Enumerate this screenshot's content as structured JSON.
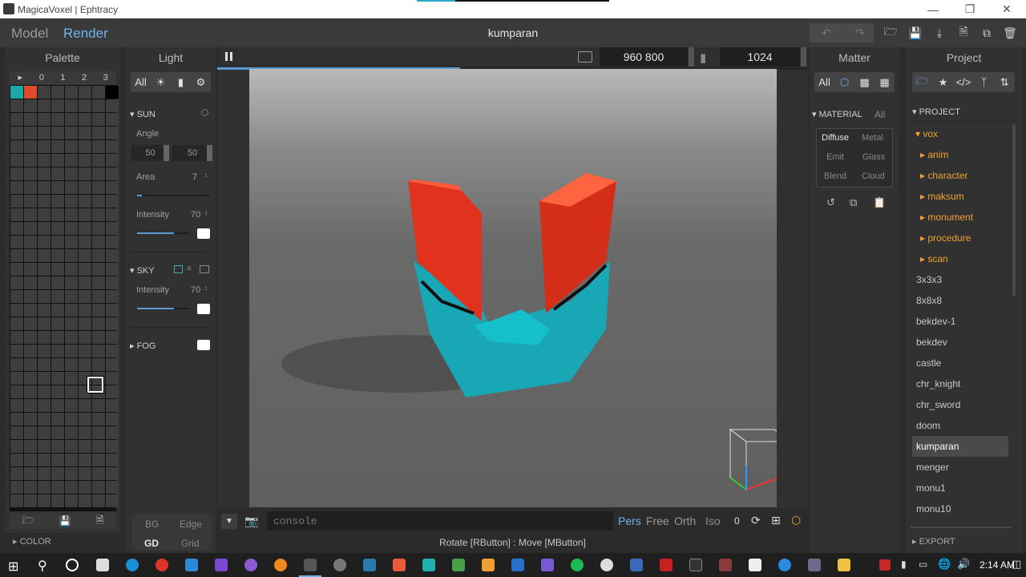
{
  "window": {
    "title": "MagicaVoxel | Ephtracy"
  },
  "appbar": {
    "mode_model": "Model",
    "mode_render": "Render",
    "doc_title": "kumparan"
  },
  "palette": {
    "header": "Palette",
    "page_tabs": [
      "▸",
      "0",
      "1",
      "2",
      "3"
    ],
    "colors": [
      "#1aa7a8",
      "#e04a2a"
    ],
    "footer_label": "COLOR"
  },
  "light": {
    "header": "Light",
    "filter_all": "All",
    "sun": {
      "label": "SUN",
      "angle_label": "Angle",
      "angle_a": "50",
      "angle_b": "50",
      "area_label": "Area",
      "area_value": "7",
      "intensity_label": "Intensity",
      "intensity_value": "70",
      "intensity_fraction": 0.7
    },
    "sky": {
      "label": "SKY",
      "intensity_label": "Intensity",
      "intensity_value": "70",
      "intensity_fraction": 0.7
    },
    "fog_label": "FOG",
    "bottom": {
      "bg": "BG",
      "edge": "Edge",
      "gd": "GD",
      "grid": "Grid"
    }
  },
  "render_toolbar": {
    "resolution": "960  800",
    "samples": "1024",
    "progress_fraction": 0.43
  },
  "console": {
    "placeholder": "console",
    "views": [
      "Pers",
      "Free",
      "Orth",
      "Iso"
    ],
    "iso_value": "0",
    "status": "Rotate [RButton] : Move [MButton]"
  },
  "matter": {
    "header": "Matter",
    "filter_all": "All",
    "material_label": "MATERIAL",
    "material_all": "All",
    "materials": [
      "Diffuse",
      "Metal",
      "Emit",
      "Glass",
      "Blend",
      "Cloud"
    ]
  },
  "project": {
    "header": "Project",
    "section": "PROJECT",
    "root_folder": "vox",
    "folders": [
      "anim",
      "character",
      "maksum",
      "monument",
      "procedure",
      "scan"
    ],
    "files": [
      "3x3x3",
      "8x8x8",
      "bekdev-1",
      "bekdev",
      "castle",
      "chr_knight",
      "chr_sword",
      "doom",
      "kumparan",
      "menger",
      "monu1",
      "monu10"
    ],
    "selected": "kumparan",
    "export_label": "EXPORT"
  },
  "taskbar": {
    "time": "2:14 AM"
  },
  "colors": {
    "accent": "#5b9bd5",
    "folder": "#f0a030",
    "teal": "#1aa7a8",
    "red": "#e04a2a"
  }
}
